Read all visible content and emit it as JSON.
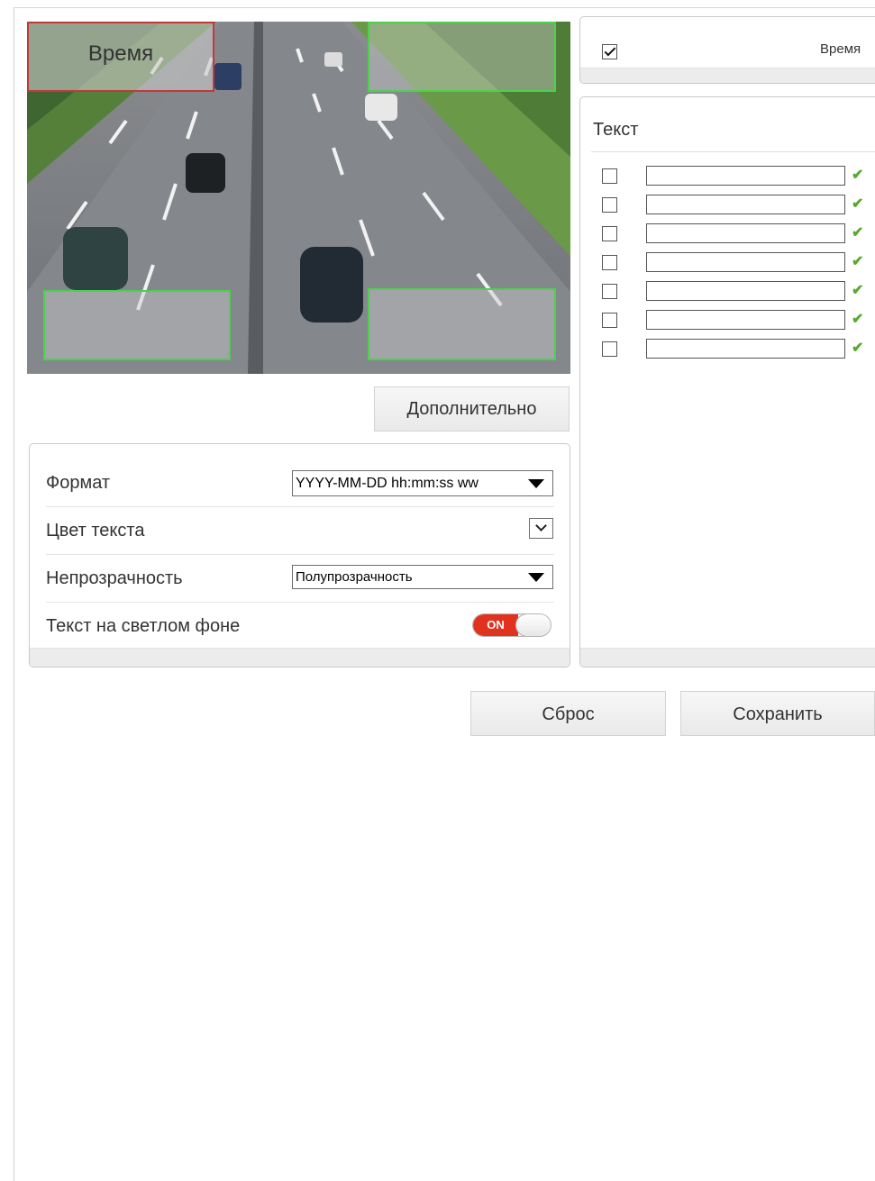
{
  "preview": {
    "time_overlay_label": "Время"
  },
  "advanced_button": "Дополнительно",
  "settings": {
    "format_label": "Формат",
    "format_value": "YYYY-MM-DD hh:mm:ss ww",
    "text_color_label": "Цвет текста",
    "text_color_value": "",
    "opacity_label": "Непрозрачность",
    "opacity_value": "Полупрозрачность",
    "light_bg_label": "Текст на светлом фоне",
    "light_bg_toggle": "ON"
  },
  "right_panel": {
    "time_checkbox_checked": true,
    "time_label": "Время",
    "text_section_title": "Текст",
    "text_rows": [
      {
        "checked": false,
        "value": ""
      },
      {
        "checked": false,
        "value": ""
      },
      {
        "checked": false,
        "value": ""
      },
      {
        "checked": false,
        "value": ""
      },
      {
        "checked": false,
        "value": ""
      },
      {
        "checked": false,
        "value": ""
      },
      {
        "checked": false,
        "value": ""
      }
    ]
  },
  "actions": {
    "reset_label": "Сброс",
    "save_label": "Сохранить"
  },
  "colors": {
    "toggle_on": "#e0321f",
    "overlay_active_border": "#c0393b",
    "overlay_border": "#4cd14c",
    "confirm_check": "#5aa832"
  },
  "icons": {
    "dropdown": "triangle-down",
    "confirm": "check-mark"
  }
}
